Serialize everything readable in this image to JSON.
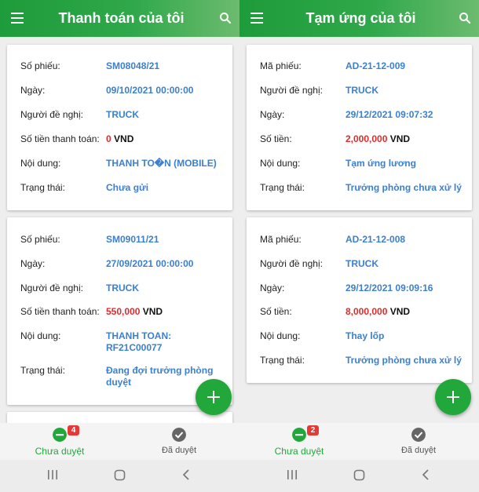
{
  "colors": {
    "primary": "#22a83a",
    "link": "#3b7fd0",
    "amount": "#e02b2b",
    "badge": "#e53935"
  },
  "left": {
    "title": "Thanh toán của tôi",
    "cards": [
      {
        "rows": [
          {
            "label": "Số phiếu:",
            "value": "SM08048/21"
          },
          {
            "label": "Ngày:",
            "value": "09/10/2021 00:00:00"
          },
          {
            "label": "Người đề nghị:",
            "value": "TRUCK"
          },
          {
            "label": "Số tiền thanh toán:",
            "amount": "0",
            "unit": "VND"
          },
          {
            "label": "Nội dung:",
            "value": "THANH TO�N (MOBILE)"
          },
          {
            "label": "Trạng thái:",
            "value": "Chưa gửi"
          }
        ]
      },
      {
        "rows": [
          {
            "label": "Số phiếu:",
            "value": "SM09011/21"
          },
          {
            "label": "Ngày:",
            "value": "27/09/2021 00:00:00"
          },
          {
            "label": "Người đề nghị:",
            "value": "TRUCK"
          },
          {
            "label": "Số tiền thanh toán:",
            "amount": "550,000",
            "unit": "VND"
          },
          {
            "label": "Nội dung:",
            "value_line1": "THANH TOAN:",
            "value_line2": "RF21C00077"
          },
          {
            "label": "Trạng thái:",
            "value_line1": "Đang đợi trưởng phòng",
            "value_line2": "duyệt"
          }
        ]
      }
    ],
    "tabs": {
      "pending_label": "Chưa duyệt",
      "pending_badge": "4",
      "approved_label": "Đã duyệt"
    }
  },
  "right": {
    "title": "Tạm ứng của tôi",
    "cards": [
      {
        "rows": [
          {
            "label": "Mã phiếu:",
            "value": "AD-21-12-009"
          },
          {
            "label": "Người đề nghị:",
            "value": "TRUCK"
          },
          {
            "label": "Ngày:",
            "value": "29/12/2021 09:07:32"
          },
          {
            "label": "Số tiền:",
            "amount": "2,000,000",
            "unit": "VND"
          },
          {
            "label": "Nội dung:",
            "value": "Tạm ứng lương"
          },
          {
            "label": "Trạng thái:",
            "value": "Trưởng phòng chưa xử lý"
          }
        ]
      },
      {
        "rows": [
          {
            "label": "Mã phiếu:",
            "value": "AD-21-12-008"
          },
          {
            "label": "Người đề nghị:",
            "value": "TRUCK"
          },
          {
            "label": "Ngày:",
            "value": "29/12/2021 09:09:16"
          },
          {
            "label": "Số tiền:",
            "amount": "8,000,000",
            "unit": "VND"
          },
          {
            "label": "Nội dung:",
            "value": "Thay lốp"
          },
          {
            "label": "Trạng thái:",
            "value": "Trưởng phòng chưa xử lý"
          }
        ]
      }
    ],
    "tabs": {
      "pending_label": "Chưa duyệt",
      "pending_badge": "2",
      "approved_label": "Đã duyệt"
    }
  },
  "icons": {
    "menu": "hamburger-menu-icon",
    "search": "search-icon",
    "add": "plus-icon",
    "pending": "minus-circle-icon",
    "approved": "check-circle-icon",
    "recents": "recents-icon",
    "home": "home-icon",
    "back": "back-icon"
  }
}
